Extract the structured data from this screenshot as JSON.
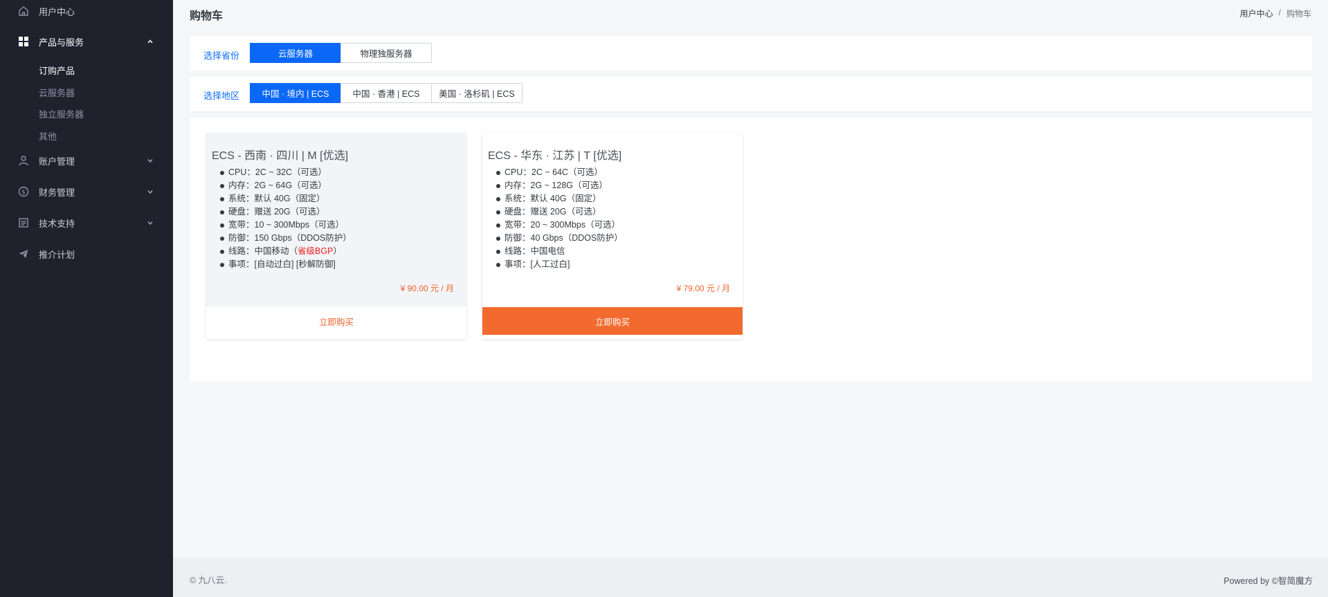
{
  "sidebar": {
    "items": [
      {
        "label": "用户中心",
        "icon": "home-icon"
      },
      {
        "label": "产品与服务",
        "icon": "grid-icon"
      },
      {
        "label": "账户管理",
        "icon": "user-icon"
      },
      {
        "label": "财务管理",
        "icon": "dollar-icon"
      },
      {
        "label": "技术支持",
        "icon": "document-icon"
      },
      {
        "label": "推介计划",
        "icon": "send-icon"
      }
    ],
    "sub_items": [
      "订购产品",
      "云服务器",
      "独立服务器",
      "其他"
    ]
  },
  "header": {
    "title": "购物车",
    "breadcrumb": [
      "用户中心",
      "/",
      "购物车"
    ]
  },
  "province": {
    "label": "选择省份",
    "options": [
      "云服务器",
      "物理独服务器"
    ],
    "selected": "云服务器"
  },
  "region": {
    "label": "选择地区",
    "options": [
      "中国 · 境内 | ECS",
      "中国 · 香港 | ECS",
      "美国 · 洛杉矶 | ECS"
    ],
    "selected": "中国 · 境内 | ECS"
  },
  "products": [
    {
      "name": "ECS - 西南 · 四川 | M [优选]",
      "specs": [
        "CPU：2C ~ 32C（可选）",
        "内存：2G ~ 64G（可选）",
        "系统：默认 40G（固定）",
        "硬盘：赠送 20G（可选）",
        "宽带：10 ~ 300Mbps（可选）",
        "防御：150 Gbps（DDOS防护）",
        "线路：中国移动（",
        "事项：[自动过白] [秒解防御]"
      ],
      "spec_highlight": "省级BGP",
      "spec_highlight_suffix": "）",
      "price": "¥ 90.00 元 / 月",
      "buy_label": "立即购买"
    },
    {
      "name": "ECS - 华东 · 江苏 | T [优选]",
      "specs": [
        "CPU：2C ~ 64C（可选）",
        "内存：2G ~ 128G（可选）",
        "系统：默认 40G（固定）",
        "硬盘：赠送 20G（可选）",
        "宽带：20 ~ 300Mbps（可选）",
        "防御：40 Gbps（DDOS防护）",
        "线路：中国电信",
        "事项：[人工过白]"
      ],
      "price": "¥ 79.00 元 / 月",
      "buy_label": "立即购买"
    }
  ],
  "footer": {
    "copyright": "© 九八云.",
    "powered": "Powered by ©智简魔方"
  },
  "colors": {
    "sidebar_bg": "#21212e",
    "primary": "#0b68f7",
    "accent": "#f26a2e",
    "highlight": "#e81e1e"
  }
}
